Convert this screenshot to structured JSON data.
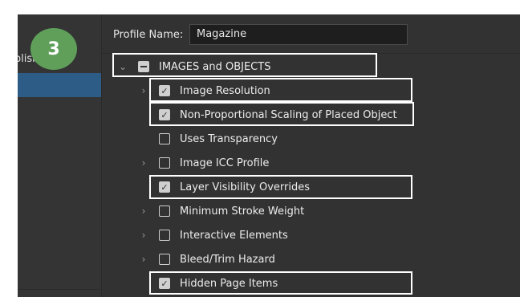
{
  "step_badge": "3",
  "sidebar": {
    "partial_label": "Publishing"
  },
  "profile": {
    "label": "Profile Name:",
    "value": "Magazine"
  },
  "category": {
    "label": "IMAGES and OBJECTS",
    "state": "mixed",
    "expanded": true
  },
  "items": [
    {
      "label": "Image Resolution",
      "checked": true,
      "expandable": true,
      "highlighted": true
    },
    {
      "label": "Non-Proportional Scaling of Placed Object",
      "checked": true,
      "expandable": false,
      "highlighted": true
    },
    {
      "label": "Uses Transparency",
      "checked": false,
      "expandable": false,
      "highlighted": false
    },
    {
      "label": "Image ICC Profile",
      "checked": false,
      "expandable": true,
      "highlighted": false
    },
    {
      "label": "Layer Visibility Overrides",
      "checked": true,
      "expandable": false,
      "highlighted": true
    },
    {
      "label": "Minimum Stroke Weight",
      "checked": false,
      "expandable": true,
      "highlighted": false
    },
    {
      "label": "Interactive Elements",
      "checked": false,
      "expandable": true,
      "highlighted": false
    },
    {
      "label": "Bleed/Trim Hazard",
      "checked": false,
      "expandable": true,
      "highlighted": false
    },
    {
      "label": "Hidden Page Items",
      "checked": true,
      "expandable": false,
      "highlighted": true
    }
  ],
  "colors": {
    "panel": "#343434",
    "selection": "#2d5d86",
    "badge": "#5f9f5a",
    "highlight": "#ffffff"
  }
}
